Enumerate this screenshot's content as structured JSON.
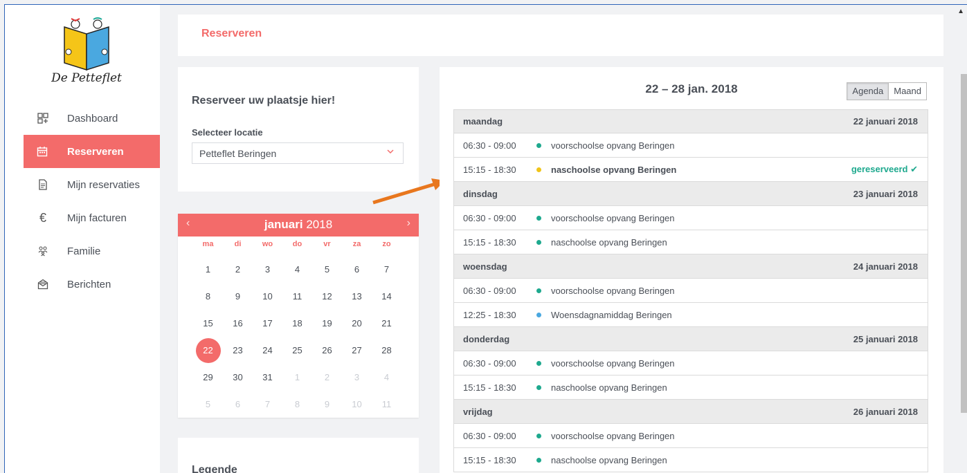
{
  "app": {
    "logo_text": "De Petteflet"
  },
  "sidebar": {
    "items": [
      {
        "label": "Dashboard",
        "icon": "dashboard-icon",
        "active": false
      },
      {
        "label": "Reserveren",
        "icon": "calendar-icon",
        "active": true
      },
      {
        "label": "Mijn reservaties",
        "icon": "document-icon",
        "active": false
      },
      {
        "label": "Mijn facturen",
        "icon": "euro-icon",
        "active": false
      },
      {
        "label": "Familie",
        "icon": "family-icon",
        "active": false
      },
      {
        "label": "Berichten",
        "icon": "mail-icon",
        "active": false
      }
    ]
  },
  "header": {
    "title": "Reserveren"
  },
  "location": {
    "heading": "Reserveer uw plaatsje hier!",
    "label": "Selecteer locatie",
    "selected": "Petteflet Beringen"
  },
  "calendar": {
    "month": "januari",
    "year": "2018",
    "weekdays": [
      "ma",
      "di",
      "wo",
      "do",
      "vr",
      "za",
      "zo"
    ],
    "days": [
      {
        "d": "1"
      },
      {
        "d": "2"
      },
      {
        "d": "3"
      },
      {
        "d": "4"
      },
      {
        "d": "5"
      },
      {
        "d": "6"
      },
      {
        "d": "7"
      },
      {
        "d": "8"
      },
      {
        "d": "9"
      },
      {
        "d": "10"
      },
      {
        "d": "11"
      },
      {
        "d": "12"
      },
      {
        "d": "13"
      },
      {
        "d": "14"
      },
      {
        "d": "15"
      },
      {
        "d": "16"
      },
      {
        "d": "17"
      },
      {
        "d": "18"
      },
      {
        "d": "19"
      },
      {
        "d": "20"
      },
      {
        "d": "21"
      },
      {
        "d": "22",
        "today": true
      },
      {
        "d": "23"
      },
      {
        "d": "24"
      },
      {
        "d": "25"
      },
      {
        "d": "26"
      },
      {
        "d": "27"
      },
      {
        "d": "28"
      },
      {
        "d": "29"
      },
      {
        "d": "30"
      },
      {
        "d": "31"
      },
      {
        "d": "1",
        "muted": true
      },
      {
        "d": "2",
        "muted": true
      },
      {
        "d": "3",
        "muted": true
      },
      {
        "d": "4",
        "muted": true
      },
      {
        "d": "5",
        "muted": true
      },
      {
        "d": "6",
        "muted": true
      },
      {
        "d": "7",
        "muted": true
      },
      {
        "d": "8",
        "muted": true
      },
      {
        "d": "9",
        "muted": true
      },
      {
        "d": "10",
        "muted": true
      },
      {
        "d": "11",
        "muted": true
      }
    ]
  },
  "legend": {
    "title": "Legende"
  },
  "agenda": {
    "range": "22 – 28 jan. 2018",
    "views": [
      {
        "label": "Agenda",
        "active": true
      },
      {
        "label": "Maand",
        "active": false
      }
    ],
    "days": [
      {
        "name": "maandag",
        "date": "22 januari 2018",
        "events": [
          {
            "time": "06:30 - 09:00",
            "title": "voorschoolse opvang Beringen",
            "color": "#1ea98e"
          },
          {
            "time": "15:15 - 18:30",
            "title": "naschoolse opvang Beringen",
            "color": "#f0c419",
            "bold": true,
            "status": "gereserveerd ✔"
          }
        ]
      },
      {
        "name": "dinsdag",
        "date": "23 januari 2018",
        "events": [
          {
            "time": "06:30 - 09:00",
            "title": "voorschoolse opvang Beringen",
            "color": "#1ea98e"
          },
          {
            "time": "15:15 - 18:30",
            "title": "naschoolse opvang Beringen",
            "color": "#1ea98e"
          }
        ]
      },
      {
        "name": "woensdag",
        "date": "24 januari 2018",
        "events": [
          {
            "time": "06:30 - 09:00",
            "title": "voorschoolse opvang Beringen",
            "color": "#1ea98e"
          },
          {
            "time": "12:25 - 18:30",
            "title": "Woensdagnamiddag Beringen",
            "color": "#4aa8e0"
          }
        ]
      },
      {
        "name": "donderdag",
        "date": "25 januari 2018",
        "events": [
          {
            "time": "06:30 - 09:00",
            "title": "voorschoolse opvang Beringen",
            "color": "#1ea98e"
          },
          {
            "time": "15:15 - 18:30",
            "title": "naschoolse opvang Beringen",
            "color": "#1ea98e"
          }
        ]
      },
      {
        "name": "vrijdag",
        "date": "26 januari 2018",
        "events": [
          {
            "time": "06:30 - 09:00",
            "title": "voorschoolse opvang Beringen",
            "color": "#1ea98e"
          },
          {
            "time": "15:15 - 18:30",
            "title": "naschoolse opvang Beringen",
            "color": "#1ea98e"
          }
        ]
      }
    ]
  },
  "colors": {
    "accent": "#f36b6a",
    "success": "#1ea98e"
  }
}
